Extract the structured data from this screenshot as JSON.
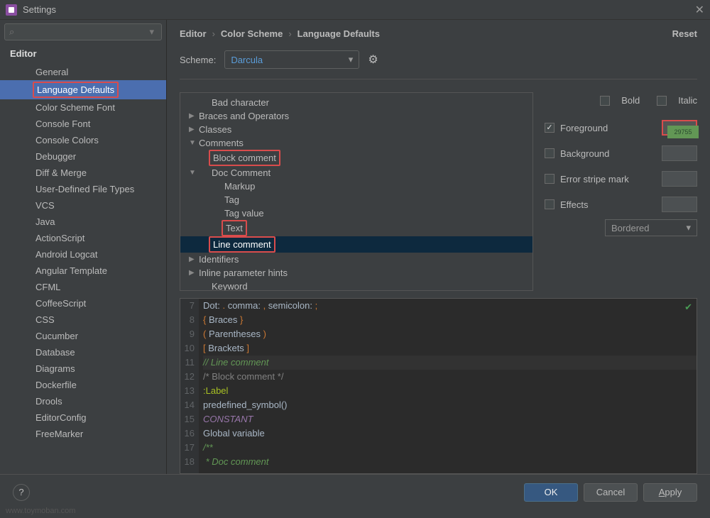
{
  "window": {
    "title": "Settings"
  },
  "search": {
    "icon": "⌕",
    "placeholder": ""
  },
  "sidebar": {
    "header": "Editor",
    "items": [
      {
        "label": "General"
      },
      {
        "label": "Language Defaults",
        "selected": true,
        "boxed": true
      },
      {
        "label": "Color Scheme Font"
      },
      {
        "label": "Console Font"
      },
      {
        "label": "Console Colors"
      },
      {
        "label": "Debugger"
      },
      {
        "label": "Diff & Merge"
      },
      {
        "label": "User-Defined File Types"
      },
      {
        "label": "VCS"
      },
      {
        "label": "Java"
      },
      {
        "label": "ActionScript"
      },
      {
        "label": "Android Logcat"
      },
      {
        "label": "Angular Template"
      },
      {
        "label": "CFML"
      },
      {
        "label": "CoffeeScript"
      },
      {
        "label": "CSS"
      },
      {
        "label": "Cucumber"
      },
      {
        "label": "Database"
      },
      {
        "label": "Diagrams"
      },
      {
        "label": "Dockerfile"
      },
      {
        "label": "Drools"
      },
      {
        "label": "EditorConfig"
      },
      {
        "label": "FreeMarker"
      }
    ]
  },
  "breadcrumb": {
    "p1": "Editor",
    "p2": "Color Scheme",
    "p3": "Language Defaults",
    "reset": "Reset"
  },
  "scheme": {
    "label": "Scheme:",
    "value": "Darcula"
  },
  "attrTree": [
    {
      "label": "Bad character",
      "indent": 1
    },
    {
      "label": "Braces and Operators",
      "indent": 0,
      "arrow": "▶"
    },
    {
      "label": "Classes",
      "indent": 0,
      "arrow": "▶"
    },
    {
      "label": "Comments",
      "indent": 0,
      "arrow": "▼"
    },
    {
      "label": "Block comment",
      "indent": 1,
      "boxed": true
    },
    {
      "label": "Doc Comment",
      "indent": 1,
      "arrow": "▼"
    },
    {
      "label": "Markup",
      "indent": 2
    },
    {
      "label": "Tag",
      "indent": 2
    },
    {
      "label": "Tag value",
      "indent": 2
    },
    {
      "label": "Text",
      "indent": 2,
      "boxed": true
    },
    {
      "label": "Line comment",
      "indent": 1,
      "boxed": true,
      "selected": true
    },
    {
      "label": "Identifiers",
      "indent": 0,
      "arrow": "▶"
    },
    {
      "label": "Inline parameter hints",
      "indent": 0,
      "arrow": "▶"
    },
    {
      "label": "Keyword",
      "indent": 1
    }
  ],
  "attrPanel": {
    "bold": "Bold",
    "italic": "Italic",
    "foreground": "Foreground",
    "fg_checked": true,
    "fg_color": "29755",
    "background": "Background",
    "error": "Error stripe mark",
    "effects": "Effects",
    "effect_type": "Bordered"
  },
  "preview": {
    "lines": [
      {
        "n": 7,
        "html": "Dot: <span class='c-pink'>.</span> comma: <span class='c-pink'>,</span> semicolon: <span class='c-pink'>;</span>"
      },
      {
        "n": 8,
        "html": "<span class='c-pink'>{</span> Braces <span class='c-pink'>}</span>"
      },
      {
        "n": 9,
        "html": "<span class='c-pink'>(</span> Parentheses <span class='c-pink'>)</span>"
      },
      {
        "n": 10,
        "html": "<span class='c-pink'>[</span> Brackets <span class='c-pink'>]</span>"
      },
      {
        "n": 11,
        "html": "<span class='c-green'>// Line comment</span>",
        "hl": true
      },
      {
        "n": 12,
        "html": "<span class='c-teal'>/* Block comment */</span>"
      },
      {
        "n": 13,
        "html": "<span class='c-label'>:Label</span>"
      },
      {
        "n": 14,
        "html": "predefined_symbol()"
      },
      {
        "n": 15,
        "html": "<span class='c-const'>CONSTANT</span>"
      },
      {
        "n": 16,
        "html": "Global variable"
      },
      {
        "n": 17,
        "html": "<span class='c-green'>/**</span>"
      },
      {
        "n": 18,
        "html": "<span class='c-green'> * Doc comment</span>"
      }
    ]
  },
  "footer": {
    "ok": "OK",
    "cancel": "Cancel",
    "apply": "Apply"
  },
  "watermark": "www.toymoban.com"
}
